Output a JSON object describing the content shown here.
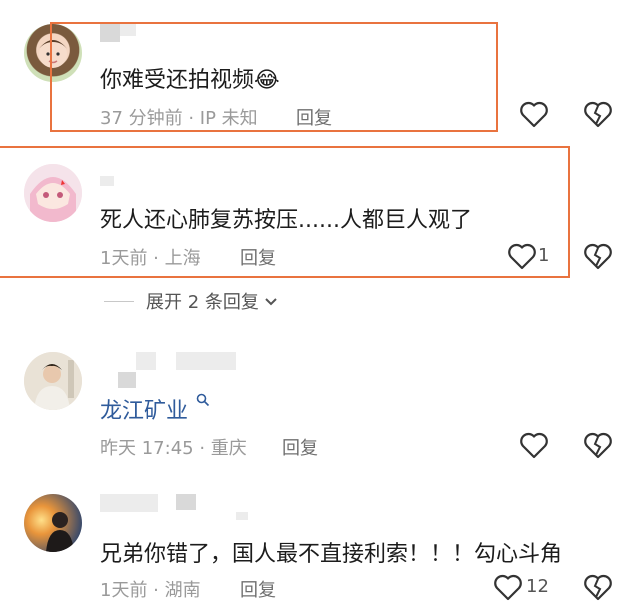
{
  "comments": [
    {
      "text": "你难受还拍视频",
      "emoji": "😂",
      "time": "37 分钟前 · IP 未知",
      "reply": "回复",
      "likes": ""
    },
    {
      "text": "死人还心肺复苏按压......人都巨人观了",
      "time": "1天前 · 上海",
      "reply": "回复",
      "likes": "1"
    },
    {
      "name": "龙江矿业",
      "time": "昨天 17:45 · 重庆",
      "reply": "回复",
      "likes": ""
    },
    {
      "text": "兄弟你错了，国人最不直接利索！！！勾心斗角",
      "time": "1天前 · 湖南",
      "reply": "回复",
      "likes": "12"
    }
  ],
  "expand_replies": "展开 2 条回复",
  "colors": {
    "highlight": "#e9733f",
    "name_blue": "#2f5b9b"
  },
  "icons": [
    "heart-outline-icon",
    "broken-heart-icon",
    "chevron-down-icon",
    "search-icon"
  ]
}
